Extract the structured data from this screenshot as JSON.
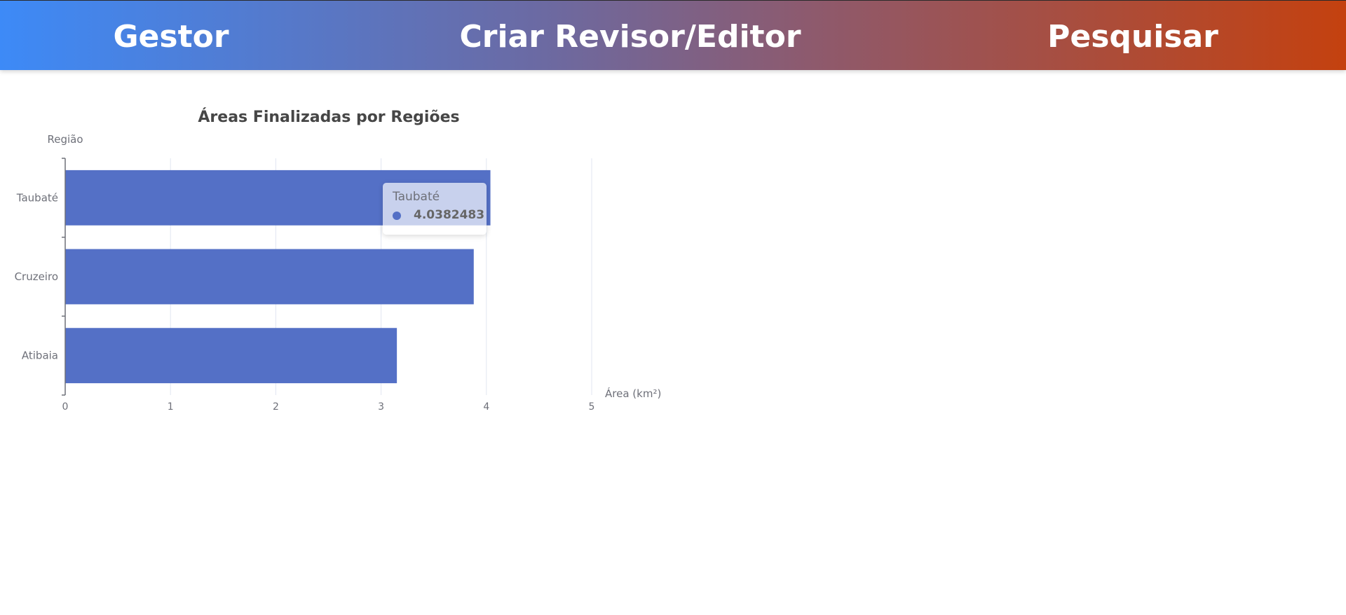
{
  "nav": {
    "items": [
      {
        "label": "Gestor"
      },
      {
        "label": "Criar Revisor/Editor"
      },
      {
        "label": "Pesquisar"
      }
    ]
  },
  "chart_data": {
    "type": "bar",
    "orientation": "horizontal",
    "title": "Áreas Finalizadas por Regiões",
    "xlabel": "Área (km²)",
    "ylabel": "Região",
    "categories": [
      "Atibaia",
      "Cruzeiro",
      "Taubaté"
    ],
    "values": [
      3.15,
      3.88,
      4.0382483
    ],
    "xlim": [
      0,
      5
    ],
    "xticks": [
      0,
      1,
      2,
      3,
      4,
      5
    ],
    "grid": true,
    "bar_color": "#5470c6",
    "tooltip": {
      "category": "Taubaté",
      "value": "4.0382483"
    }
  }
}
